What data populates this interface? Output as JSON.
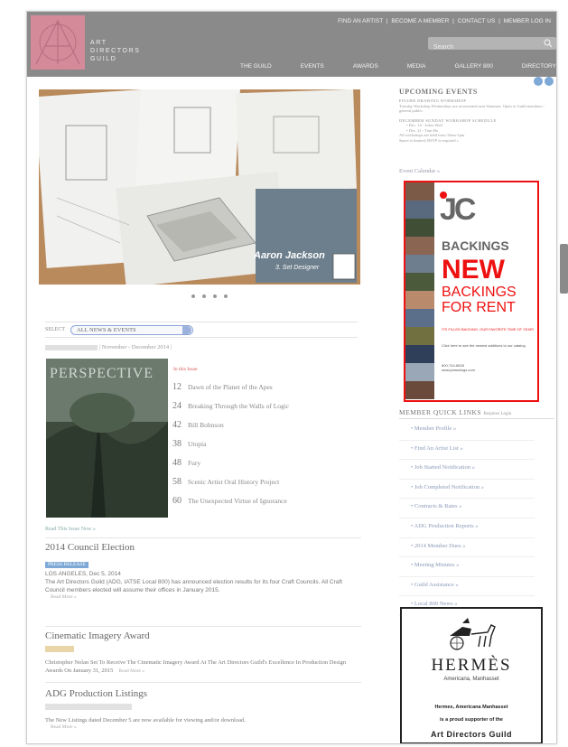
{
  "header": {
    "logo_lines": [
      "ART",
      "DIRECTORS",
      "GUILD"
    ],
    "util_nav": [
      "FIND AN ARTIST",
      "BECOME A MEMBER",
      "CONTACT US",
      "MEMBER LOG IN"
    ],
    "search_placeholder": "Search",
    "main_nav": [
      "THE GUILD",
      "EVENTS",
      "AWARDS",
      "MEDIA",
      "GALLERY 800",
      "DIRECTORY"
    ]
  },
  "hero": {
    "caption_name": "Aaron Jackson",
    "caption_role": "3. Set Designer"
  },
  "filter": {
    "label": "SELECT",
    "selected": "ALL NEWS & EVENTS"
  },
  "issue": {
    "date_range": "| November - December 2014 |",
    "magazine_title": "PERSPECTIVE",
    "in_this_issue": "In this Issue",
    "toc": [
      {
        "page": "12",
        "title": "Dawn of the Planet of the Apes"
      },
      {
        "page": "24",
        "title": "Breaking Through the Walls of Logic"
      },
      {
        "page": "42",
        "title": "Bill Bohnson"
      },
      {
        "page": "38",
        "title": "Utopia"
      },
      {
        "page": "48",
        "title": "Fury"
      },
      {
        "page": "58",
        "title": "Scenic Artist Oral History Project"
      },
      {
        "page": "60",
        "title": "The Unexpected Virtue of Ignorance"
      }
    ],
    "read_link": "Read This Issue Now »"
  },
  "articles": [
    {
      "title": "2014 Council Election",
      "tag": "PRESS RELEASE",
      "tag_color": "#7ea8d6",
      "lead": "LOS ANGELES, Dec 5, 2014",
      "body": "The Art Directors Guild (ADG, IATSE Local 800) has announced election results for its four Craft Councils. All Craft Council members elected will assume their offices in January 2015.",
      "read_more": "Read More »"
    },
    {
      "title": "Cinematic Imagery Award",
      "tag": "",
      "tag_color": "#e8d5a8",
      "body": "Christopher Nolan Set To Receive The Cinematic Imagery Award At The Art Directors Guild's Excellence In Production Design Awards On January 31, 2015",
      "read_more": "Read More »"
    },
    {
      "title": "ADG Production Listings",
      "tag": "",
      "tag_color": "#e2e2e2",
      "body": "The New Listings dated December 5 are now available for viewing and/or download.",
      "read_more": "Read More »"
    }
  ],
  "sidebar": {
    "upcoming_title": "UPCOMING EVENTS",
    "events": [
      "FIGURE DRAWING WORKSHOP",
      "Tuesday Workshop Wednesdays are reconvened next Semester. Open to Guild members / general public.",
      "DECEMBER SUNDAY WORKSHOP SCHEDULE",
      "• Dec. 14 - Joker Wolf",
      "• Dec. 21 - Tom Ho",
      "All workshops are held from 10am-1pm",
      "Space is limited; RSVP is required »"
    ],
    "calendar_link": "Event Calendar »",
    "ad_jc": {
      "logo": "JC",
      "backings": "BACKINGS",
      "new": "NEW",
      "backings_for_rent": [
        "BACKINGS",
        "FOR RENT"
      ],
      "small_red": "ITS FILLED BACKING. OUR FAVORITE TIME OF YEAR!",
      "small_gray": "Click here to see the newest additions to our catalog",
      "contact": [
        "800-744-8828",
        "www.jcbackings.com"
      ]
    },
    "quick_title": "MEMBER QUICK LINKS",
    "quick_sub": "Requires Login",
    "quick_links": [
      "• Member Profile »",
      "• Find An Artist List »",
      "• Job Started Notification »",
      "• Job Completed Notification »",
      "• Contracts & Rates »",
      "• ADG Production Reports »",
      "• 2014 Member Dues »",
      "• Meeting Minutes »",
      "• Guild Assistance »",
      "• Local 800 News »"
    ],
    "ad_hermes": {
      "logo": "HERMÈS",
      "sub": "Americana, Manhasset",
      "line1": "Hermes, Americana Manhasset",
      "line2": "is a proud supporter of the",
      "line3": "Art Directors Guild"
    }
  }
}
